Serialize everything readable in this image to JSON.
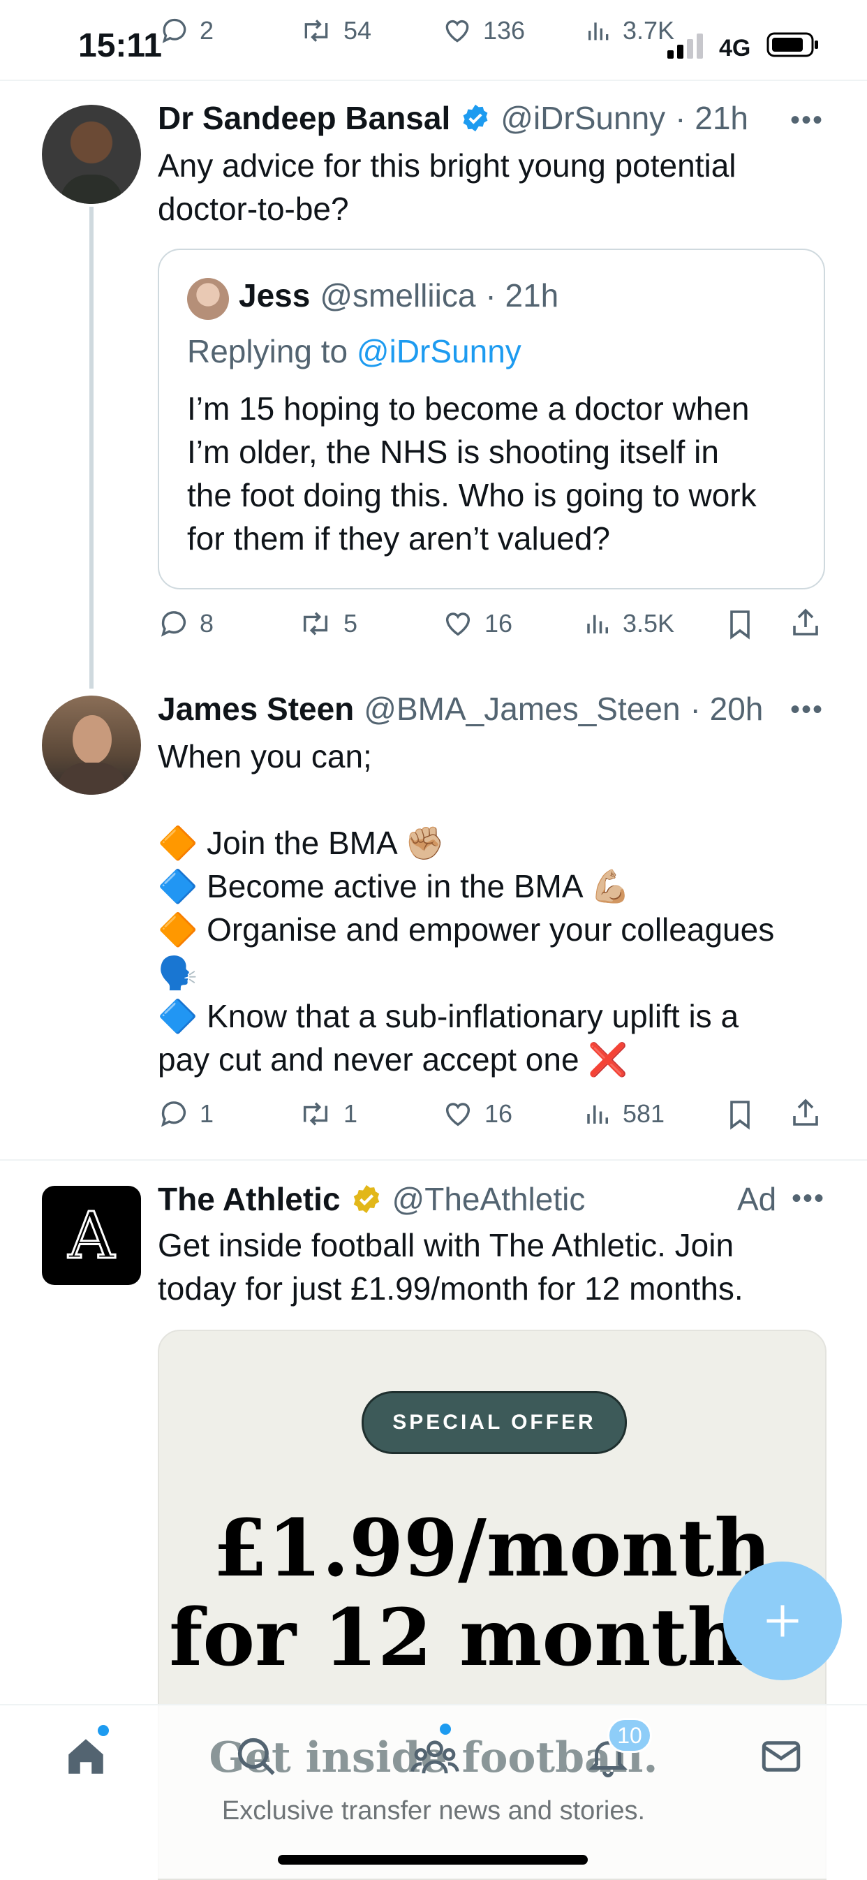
{
  "status_bar": {
    "time": "15:11",
    "network": "4G"
  },
  "top_stats": {
    "replies": "2",
    "retweets": "54",
    "likes": "136",
    "views": "3.7K"
  },
  "tweet1": {
    "name": "Dr Sandeep Bansal",
    "handle": "@iDrSunny",
    "time": "· 21h",
    "text_line1": "Any advice for this bright young potential",
    "text_line2": "doctor-to-be?",
    "quote": {
      "name": "Jess",
      "handle": "@smelliica",
      "time": "· 21h",
      "replying_prefix": "Replying to",
      "replying_handle": "@iDrSunny",
      "line1": "I’m 15 hoping to become a doctor when",
      "line2": "I’m older, the NHS is shooting itself in",
      "line3": "the foot doing this. Who is going to work",
      "line4": "for them if they aren’t valued?"
    },
    "stats": {
      "replies": "8",
      "retweets": "5",
      "likes": "16",
      "views": "3.5K"
    }
  },
  "tweet2": {
    "name": "James Steen",
    "handle": "@BMA_James_Steen",
    "time": "· 20h",
    "intro": "When you can;",
    "item1": "Join the BMA",
    "item1_emoji": "✊🏼",
    "item2": "Become active in the BMA",
    "item2_emoji": "💪🏼",
    "item3": "Organise and empower your colleagues",
    "item3_emoji": "🗣️",
    "item4_line1": "Know that a sub-inflationary uplift is a",
    "item4_line2": "pay cut and never accept one",
    "item4_emoji": "❌",
    "stats": {
      "replies": "1",
      "retweets": "1",
      "likes": "16",
      "views": "581"
    }
  },
  "ad": {
    "logo_letter": "A",
    "name": "The Athletic",
    "handle": "@TheAthletic",
    "ad_label": "Ad",
    "text_line1": "Get inside football with The Athletic. Join",
    "text_line2": "today for just £1.99/month for 12 months.",
    "media": {
      "badge": "SPECIAL OFFER",
      "price_line1": "£1.99/month",
      "price_line2": "for 12 months.",
      "caption_title": "Get inside football.",
      "caption_sub": "Exclusive transfer news and stories."
    }
  },
  "tab_bar": {
    "notifications_badge": "10"
  },
  "colors": {
    "accent": "#1d9bf0",
    "fab": "#8ecdf8",
    "ad_bg": "#efefe9",
    "badge_bg": "#3d5a59"
  }
}
